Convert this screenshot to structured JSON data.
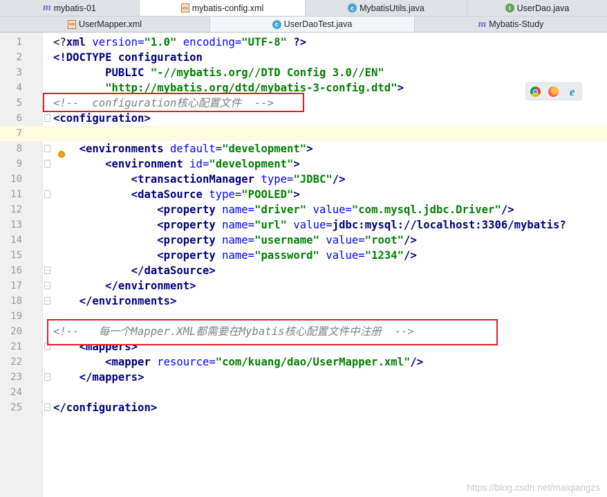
{
  "tabs_row1": [
    {
      "label": "mybatis-01",
      "icon": "module-m-icon",
      "active": false
    },
    {
      "label": "mybatis-config.xml",
      "icon": "xml-file-icon",
      "active": true
    },
    {
      "label": "MybatisUtils.java",
      "icon": "class-c-icon",
      "active": false
    },
    {
      "label": "UserDao.java",
      "icon": "interface-i-icon",
      "active": false
    }
  ],
  "tabs_row2": [
    {
      "label": "UserMapper.xml",
      "icon": "xml-file-icon",
      "active": false
    },
    {
      "label": "UserDaoTest.java",
      "icon": "class-c-icon",
      "active": true
    },
    {
      "label": "Mybatis-Study",
      "icon": "module-m-icon",
      "active": false
    }
  ],
  "editor": {
    "current_line": 7,
    "lines": [
      {
        "n": "1",
        "text": "<?xml version=\"1.0\" encoding=\"UTF-8\" ?>"
      },
      {
        "n": "2",
        "text": "<!DOCTYPE configuration"
      },
      {
        "n": "3",
        "text": "        PUBLIC \"-//mybatis.org//DTD Config 3.0//EN\""
      },
      {
        "n": "4",
        "text": "        \"http://mybatis.org/dtd/mybatis-3-config.dtd\">"
      },
      {
        "n": "5",
        "text": "<!--  configuration核心配置文件  -->"
      },
      {
        "n": "6",
        "text": "<configuration>"
      },
      {
        "n": "7",
        "text": ""
      },
      {
        "n": "8",
        "text": "    <environments default=\"development\">"
      },
      {
        "n": "9",
        "text": "        <environment id=\"development\">"
      },
      {
        "n": "10",
        "text": "            <transactionManager type=\"JDBC\"/>"
      },
      {
        "n": "11",
        "text": "            <dataSource type=\"POOLED\">"
      },
      {
        "n": "12",
        "text": "                <property name=\"driver\" value=\"com.mysql.jdbc.Driver\"/>"
      },
      {
        "n": "13",
        "text": "                <property name=\"url\" value=\"jdbc:mysql://localhost:3306/mybatis?"
      },
      {
        "n": "14",
        "text": "                <property name=\"username\" value=\"root\"/>"
      },
      {
        "n": "15",
        "text": "                <property name=\"password\" value=\"1234\"/>"
      },
      {
        "n": "16",
        "text": "            </dataSource>"
      },
      {
        "n": "17",
        "text": "        </environment>"
      },
      {
        "n": "18",
        "text": "    </environments>"
      },
      {
        "n": "19",
        "text": ""
      },
      {
        "n": "20",
        "text": "<!--   每一个Mapper.XML都需要在Mybatis核心配置文件中注册  -->"
      },
      {
        "n": "21",
        "text": "    <mappers>"
      },
      {
        "n": "22",
        "text": "        <mapper resource=\"com/kuang/dao/UserMapper.xml\"/>"
      },
      {
        "n": "23",
        "text": "    </mappers>"
      },
      {
        "n": "24",
        "text": ""
      },
      {
        "n": "25",
        "text": "</configuration>"
      }
    ]
  },
  "browser_icons": [
    "chrome-icon",
    "firefox-icon",
    "internet-explorer-icon"
  ],
  "annotation_color": "#e51c23",
  "watermark": "https://blog.csdn.net/maiqiangzs"
}
